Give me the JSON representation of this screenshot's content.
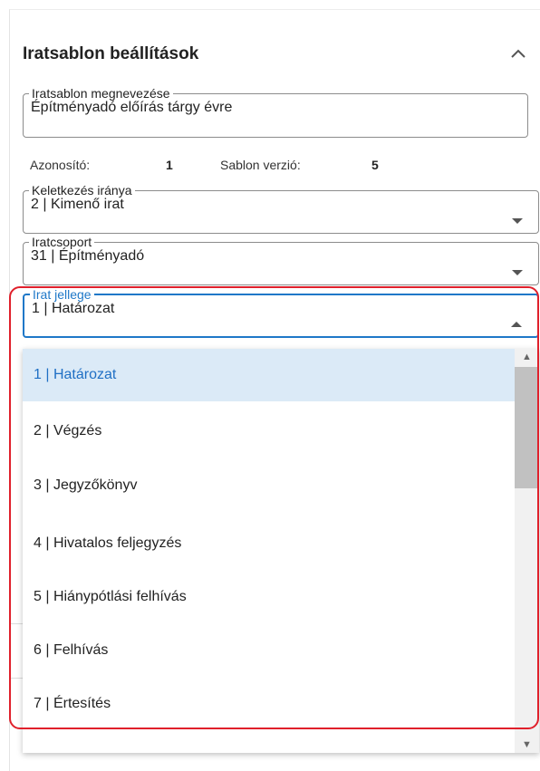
{
  "panel": {
    "title": "Iratsablon beállítások",
    "collapse_icon": "chevron-up-icon"
  },
  "fields": {
    "name": {
      "label": "Iratsablon megnevezése",
      "value": "Építményadó előírás tárgy évre"
    },
    "meta": {
      "id_label": "Azonosító:",
      "id_value": "1",
      "version_label": "Sablon verzió:",
      "version_value": "5"
    },
    "direction": {
      "label": "Keletkezés iránya",
      "value": "2 | Kimenő irat"
    },
    "group": {
      "label": "Iratcsoport",
      "value": "31 | Építményadó"
    },
    "type": {
      "label": "Irat jellege",
      "value": "1 | Határozat"
    }
  },
  "dropdown": {
    "options": [
      "1 | Határozat",
      "2 | Végzés",
      "3 | Jegyzőkönyv",
      "4 | Hivatalos feljegyzés",
      "5 | Hiánypótlási felhívás",
      "6 | Felhívás",
      "7 | Értesítés"
    ],
    "selected_index": 0
  },
  "colors": {
    "accent": "#1f78c8",
    "selected_bg": "#dbeaf7",
    "highlight": "#e0202b"
  }
}
